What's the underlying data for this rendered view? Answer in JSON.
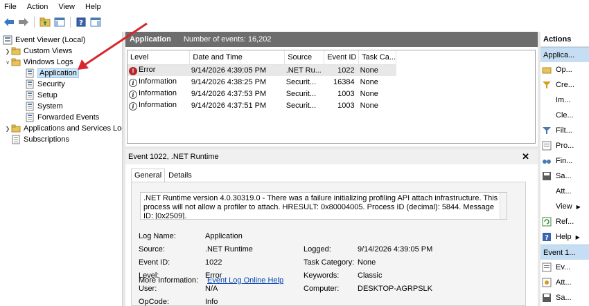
{
  "menu": [
    "File",
    "Action",
    "View",
    "Help"
  ],
  "tree": {
    "root": "Event Viewer (Local)",
    "custom_views": "Custom Views",
    "windows_logs": "Windows Logs",
    "logs": [
      "Application",
      "Security",
      "Setup",
      "System",
      "Forwarded Events"
    ],
    "apps_services": "Applications and Services Log",
    "subscriptions": "Subscriptions"
  },
  "center": {
    "title": "Application",
    "count": "Number of events: 16,202"
  },
  "table": {
    "columns": [
      "Level",
      "Date and Time",
      "Source",
      "Event ID",
      "Task Ca..."
    ],
    "rows": [
      {
        "level": "Error",
        "datetime": "9/14/2026 4:39:05 PM",
        "source": ".NET Ru...",
        "event_id": "1022",
        "task": "None"
      },
      {
        "level": "Information",
        "datetime": "9/14/2026 4:38:25 PM",
        "source": "Securit...",
        "event_id": "16384",
        "task": "None"
      },
      {
        "level": "Information",
        "datetime": "9/14/2026 4:37:53 PM",
        "source": "Securit...",
        "event_id": "1003",
        "task": "None"
      },
      {
        "level": "Information",
        "datetime": "9/14/2026 4:37:51 PM",
        "source": "Securit...",
        "event_id": "1003",
        "task": "None"
      }
    ]
  },
  "detail": {
    "title": "Event 1022, .NET Runtime",
    "close": "✕",
    "tabs": [
      "General",
      "Details"
    ],
    "description": ".NET Runtime version 4.0.30319.0 - There was a failure initializing profiling API attach infrastructure.  This process will not allow a profiler to attach.  HRESULT: 0x80004005.  Process ID (decimal): 5844.  Message ID: [0x2509].",
    "fields": {
      "log_name_label": "Log Name:",
      "log_name": "Application",
      "source_label": "Source:",
      "source": ".NET Runtime",
      "event_id_label": "Event ID:",
      "event_id": "1022",
      "level_label": "Level:",
      "level": "Error",
      "user_label": "User:",
      "user": "N/A",
      "opcode_label": "OpCode:",
      "opcode": "Info",
      "more_info_label": "More Information:",
      "more_info": "Event Log Online Help",
      "logged_label": "Logged:",
      "logged": "9/14/2026 4:39:05 PM",
      "task_category_label": "Task Category:",
      "task_category": "None",
      "keywords_label": "Keywords:",
      "keywords": "Classic",
      "computer_label": "Computer:",
      "computer": "DESKTOP-AGRPSLK"
    }
  },
  "actions": {
    "header": "Actions",
    "section1": "Applica...",
    "items1": [
      "Op...",
      "Cre...",
      "Im...",
      "Cle...",
      "Filt...",
      "Pro...",
      "Fin...",
      "Sa...",
      "Att...",
      "View",
      "Ref...",
      "Help"
    ],
    "section2": "Event 1...",
    "items2": [
      "Ev...",
      "Att...",
      "Sa..."
    ]
  },
  "colors": {
    "header_bg": "#6d6d6d",
    "selection": "#cce4f7",
    "actions_section": "#c5def3",
    "annotation_arrow": "#d9262c"
  }
}
